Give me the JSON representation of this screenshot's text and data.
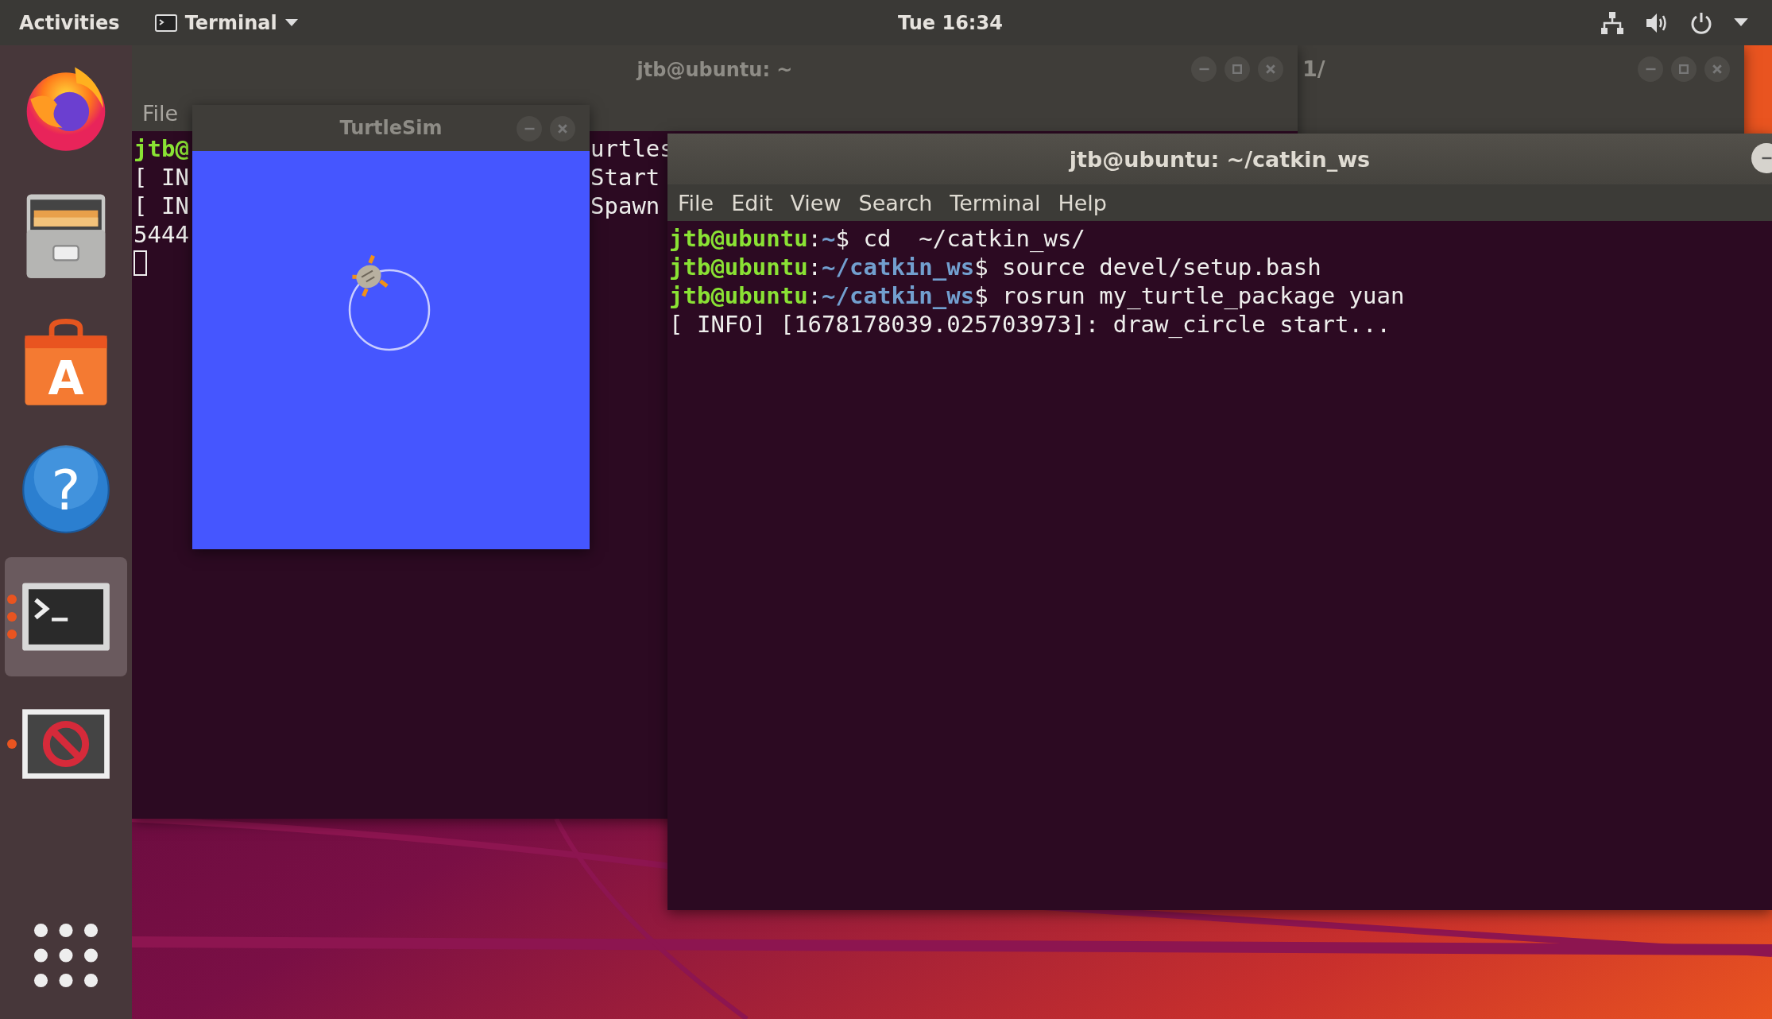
{
  "top_bar": {
    "activities": "Activities",
    "app_menu": "Terminal",
    "clock": "Tue 16:34"
  },
  "dock": {
    "items": [
      {
        "kind": "browser",
        "selected": false,
        "running": false
      },
      {
        "kind": "files",
        "selected": false,
        "running": false
      },
      {
        "kind": "software",
        "glyph": "A",
        "selected": false,
        "running": false
      },
      {
        "kind": "help",
        "glyph": "?",
        "selected": false,
        "running": false
      },
      {
        "kind": "terminal",
        "selected": true,
        "running": true,
        "multiple_windows": true
      },
      {
        "kind": "blocked",
        "selected": false,
        "running": true,
        "multiple_windows": false
      }
    ]
  },
  "background_terminal": {
    "title": "jtb@ubuntu: ~",
    "menu": [
      "File"
    ],
    "left_lines": [
      {
        "kind": "prompt",
        "text": "jtb@"
      },
      {
        "kind": "output",
        "text": "[ IN"
      },
      {
        "kind": "output",
        "text": "[ IN"
      },
      {
        "kind": "output",
        "text": "5444"
      }
    ],
    "right_lines": [
      "urtles",
      "Start",
      "Spawn"
    ],
    "cursor": true
  },
  "other_window": {
    "title": "1/"
  },
  "turtlesim": {
    "title": "TurtleSim"
  },
  "terminal": {
    "title": "jtb@ubuntu: ~/catkin_ws",
    "menu": [
      "File",
      "Edit",
      "View",
      "Search",
      "Terminal",
      "Help"
    ],
    "lines": [
      {
        "kind": "command",
        "user": "jtb@ubuntu",
        "separator": ":",
        "path": "~",
        "symbol": "$",
        "command": " cd  ~/catkin_ws/"
      },
      {
        "kind": "command",
        "user": "jtb@ubuntu",
        "separator": ":",
        "path": "~/catkin_ws",
        "symbol": "$",
        "command": " source devel/setup.bash"
      },
      {
        "kind": "command",
        "user": "jtb@ubuntu",
        "separator": ":",
        "path": "~/catkin_ws",
        "symbol": "$",
        "command": " rosrun my_turtle_package yuan"
      },
      {
        "kind": "output",
        "text": "[ INFO] [1678178039.025703973]: draw_circle start..."
      }
    ]
  }
}
